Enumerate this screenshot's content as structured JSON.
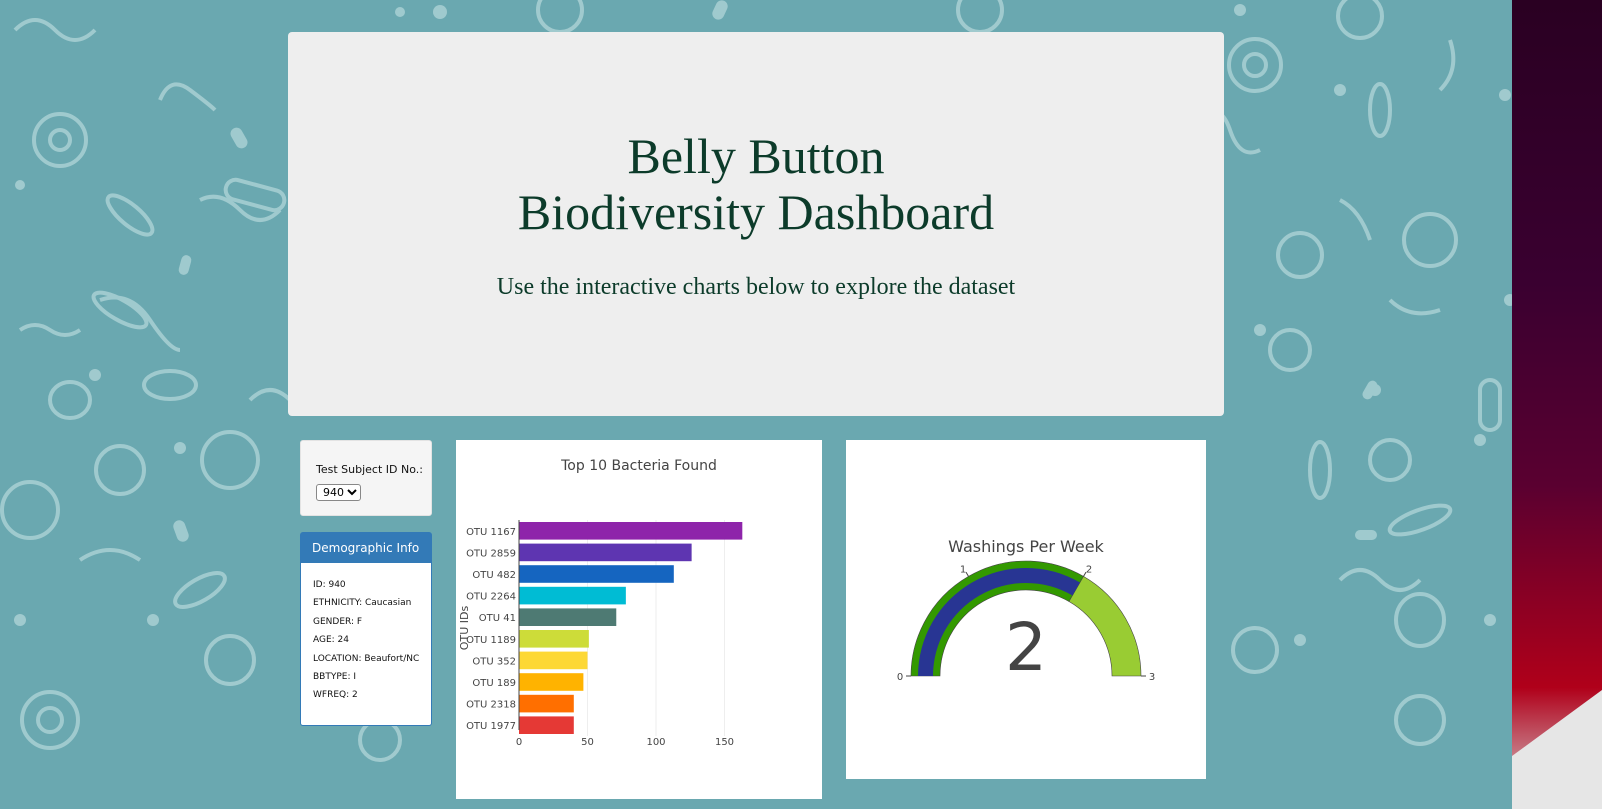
{
  "header": {
    "title": "Belly Button Biodiversity Dashboard",
    "subtitle": "Use the interactive charts below to explore the dataset"
  },
  "selector": {
    "label": "Test Subject ID No.:",
    "selected": "940"
  },
  "demographics": {
    "title": "Demographic Info",
    "rows": [
      "ID: 940",
      "ETHNICITY: Caucasian",
      "GENDER: F",
      "AGE: 24",
      "LOCATION: Beaufort/NC",
      "BBTYPE: I",
      "WFREQ: 2"
    ]
  },
  "chart_data": [
    {
      "type": "bar",
      "orientation": "horizontal",
      "title": "Top 10 Bacteria Found",
      "ylabel": "OTU IDs",
      "xlabel": "",
      "categories": [
        "OTU 1167",
        "OTU 2859",
        "OTU 482",
        "OTU 2264",
        "OTU 41",
        "OTU 1189",
        "OTU 352",
        "OTU 189",
        "OTU 2318",
        "OTU 1977"
      ],
      "values": [
        163,
        126,
        113,
        78,
        71,
        51,
        50,
        47,
        40,
        40
      ],
      "colors": [
        "#8e24aa",
        "#5e35b1",
        "#1565c0",
        "#00bcd4",
        "#4e7a73",
        "#cddc39",
        "#fdd835",
        "#ffb300",
        "#ff6f00",
        "#e53935"
      ],
      "xticks": [
        "0",
        "50",
        "100",
        "150"
      ],
      "xlim": [
        0,
        170
      ],
      "grid": true
    },
    {
      "type": "gauge",
      "title": "Washings Per Week",
      "value": 2,
      "range": [
        0,
        3
      ],
      "tick_labels": [
        "0",
        "1",
        "2",
        "3"
      ],
      "bar_color": "#283593",
      "steps": [
        {
          "range": [
            0,
            2
          ],
          "color": "#339900"
        },
        {
          "range": [
            2,
            3
          ],
          "color": "#99cc33"
        }
      ]
    }
  ]
}
